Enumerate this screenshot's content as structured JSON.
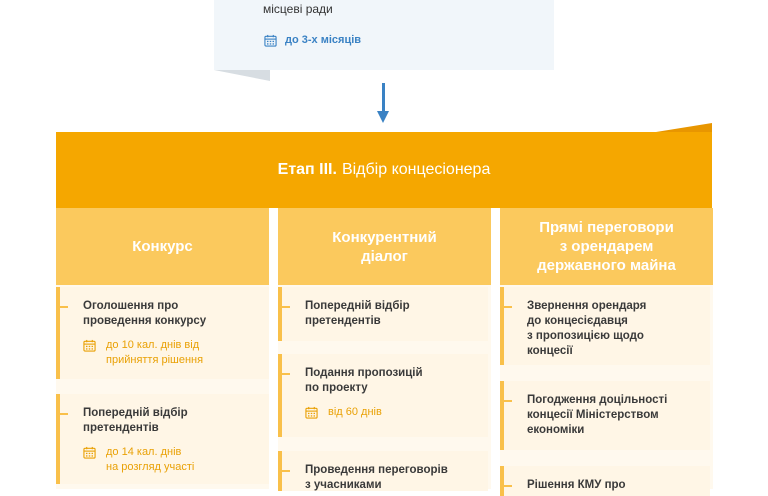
{
  "top_card": {
    "description": "місцеві ради",
    "duration": "до 3-х місяців"
  },
  "stage": {
    "prefix": "Етап III.",
    "title": "Відбір концесіонера"
  },
  "columns": [
    {
      "title": "Конкурс",
      "steps": [
        {
          "text": "Оголошення про\nпроведення конкурсу",
          "duration": "до 10 кал. днів від\nприйняття рішення"
        },
        {
          "text": "Попередній відбір\nпретендентів",
          "duration": "до 14 кал. днів\nна розгляд участі"
        }
      ]
    },
    {
      "title": "Конкурентний\nдіалог",
      "steps": [
        {
          "text": "Попередній відбір\nпретендентів"
        },
        {
          "text": "Подання пропозицій\nпо проекту",
          "duration": "від 60 днів"
        },
        {
          "text": "Проведення переговорів\nз учасниками"
        }
      ]
    },
    {
      "title": "Прямі переговори\nз орендарем\nдержавного майна",
      "steps": [
        {
          "text": "Звернення орендаря\nдо концесієдавця\nз пропозицією щодо\nконцесії"
        },
        {
          "text": "Погодження доцільності\nконцесії Міністерством\nекономіки"
        },
        {
          "text": "Рішення КМУ про"
        }
      ]
    }
  ],
  "colors": {
    "stage": "#f5a700",
    "column_header": "#fbc95d",
    "accent_blue": "#3a82c4",
    "duration_text": "#e9a106"
  },
  "icons": {
    "duration": "calendar-icon",
    "flow": "arrow-down-icon"
  }
}
